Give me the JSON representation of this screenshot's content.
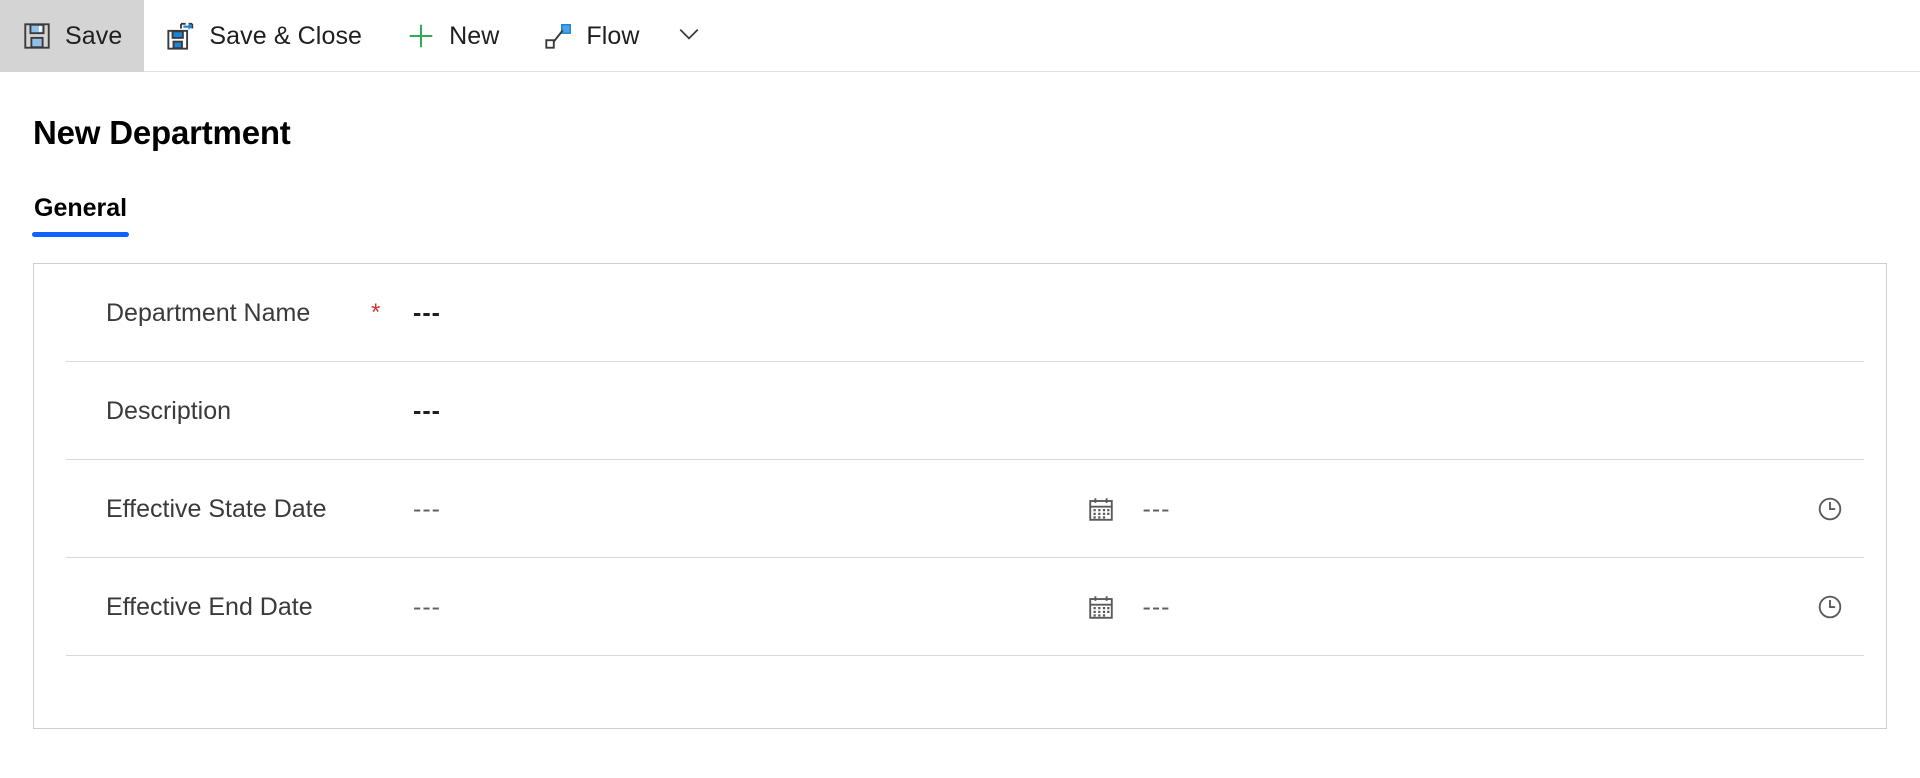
{
  "commandbar": {
    "buttons": [
      {
        "id": "save",
        "label": "Save",
        "icon": "save-icon",
        "active": true
      },
      {
        "id": "save-close",
        "label": "Save & Close",
        "icon": "save-close-icon",
        "active": false
      },
      {
        "id": "new",
        "label": "New",
        "icon": "plus-icon",
        "active": false
      },
      {
        "id": "flow",
        "label": "Flow",
        "icon": "flow-icon",
        "active": false
      }
    ],
    "overflow_icon": "chevron-down-icon"
  },
  "page": {
    "title": "New Department"
  },
  "tabs": [
    {
      "id": "general",
      "label": "General",
      "selected": true
    }
  ],
  "form": {
    "rows": [
      {
        "id": "department-name",
        "label": "Department Name",
        "required": true,
        "required_marker": "*",
        "value": "---",
        "type": "text"
      },
      {
        "id": "description",
        "label": "Description",
        "required": false,
        "required_marker": "",
        "value": "---",
        "type": "text"
      },
      {
        "id": "effective-state-date",
        "label": "Effective State Date",
        "required": false,
        "required_marker": "",
        "value": "---",
        "time_value": "---",
        "type": "datetime",
        "date_icon": "calendar-icon",
        "time_icon": "clock-icon"
      },
      {
        "id": "effective-end-date",
        "label": "Effective End Date",
        "required": false,
        "required_marker": "",
        "value": "---",
        "time_value": "---",
        "type": "datetime",
        "date_icon": "calendar-icon",
        "time_icon": "clock-icon"
      }
    ]
  },
  "colors": {
    "accent": "#0f62fe",
    "icon_blue": "#0078d4",
    "icon_dark": "#3b3a39",
    "required_red": "#d13438",
    "plus_green": "#2eac56",
    "active_button_bg": "#d4d4d4",
    "panel_border": "#cfcfcf",
    "divider": "#d9d9d9"
  }
}
